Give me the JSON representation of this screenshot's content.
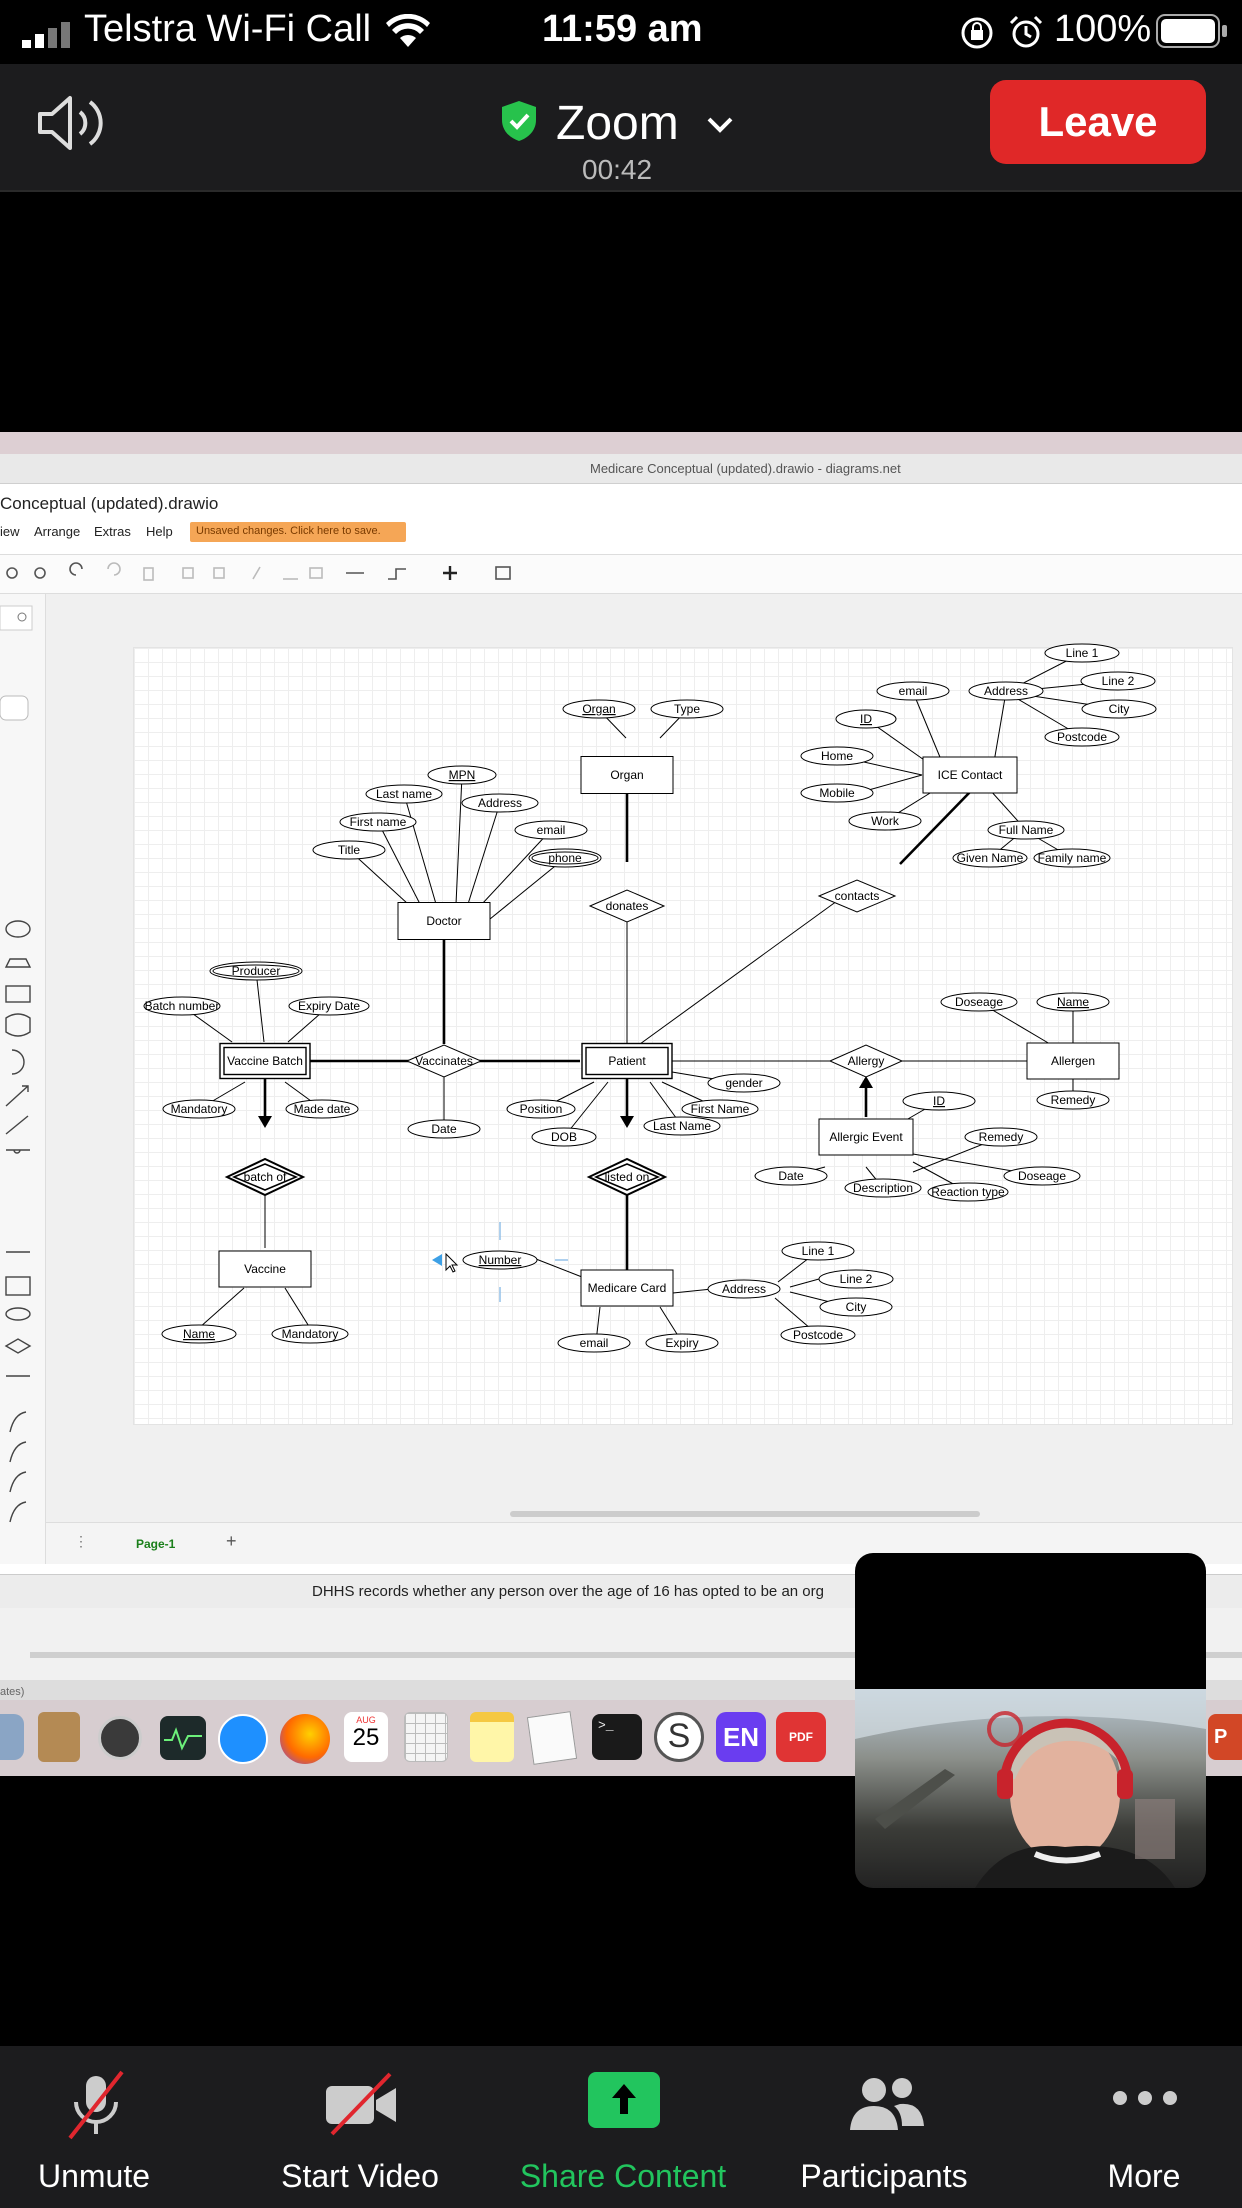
{
  "status_bar": {
    "carrier": "Telstra Wi-Fi Call",
    "time": "11:59 am",
    "battery": "100%"
  },
  "header": {
    "app_name": "Zoom",
    "timer": "00:42",
    "leave_label": "Leave"
  },
  "shared_screen": {
    "window_title": "Medicare Conceptual (updated).drawio - diagrams.net",
    "doc_title": "Conceptual (updated).drawio",
    "menu": [
      "iew",
      "Arrange",
      "Extras",
      "Help"
    ],
    "unsaved_notice": "Unsaved changes. Click here to save.",
    "page_tab": "Page-1",
    "caption": "DHHS records whether any person over the age of 16 has opted to be an org",
    "calendar_month": "AUG",
    "calendar_day": "25",
    "dock_en": "EN",
    "dock_pdf": "PDF",
    "status_fragment": "ates)",
    "diagram": {
      "entities": {
        "organ": "Organ",
        "doctor": "Doctor",
        "ice_contact": "ICE Contact",
        "vaccine_batch": "Vaccine Batch",
        "patient": "Patient",
        "allergen": "Allergen",
        "allergic_event": "Allergic Event",
        "vaccine": "Vaccine",
        "medicare_card": "Medicare Card"
      },
      "relationships": {
        "donates": "donates",
        "contacts": "contacts",
        "vaccinates": "Vaccinates",
        "allergy": "Allergy",
        "batch_of": "batch of",
        "listed_on": "listed on"
      },
      "attributes": {
        "organ_key": "Organ",
        "organ_type": "Type",
        "ice_line1": "Line 1",
        "ice_email": "email",
        "ice_address": "Address",
        "ice_line2": "Line 2",
        "ice_id": "ID",
        "ice_city": "City",
        "ice_postcode": "Postcode",
        "ice_home": "Home",
        "ice_mobile": "Mobile",
        "ice_work": "Work",
        "ice_fullname": "Full Name",
        "ice_given": "Given Name",
        "ice_family": "Family name",
        "doc_mpn": "MPN",
        "doc_lastname": "Last name",
        "doc_address": "Address",
        "doc_firstname": "First name",
        "doc_email": "email",
        "doc_title": "Title",
        "doc_phone": "phone",
        "vb_producer": "Producer",
        "vb_batchnum": "Batch number",
        "vb_expiry": "Expiry Date",
        "vb_mandatory": "Mandatory",
        "vb_madedate": "Made date",
        "vacc_date": "Date",
        "pat_gender": "gender",
        "pat_position": "Position",
        "pat_firstname": "First Name",
        "pat_dob": "DOB",
        "pat_lastname": "Last Name",
        "al_doseage": "Doseage",
        "al_name": "Name",
        "al_remedy": "Remedy",
        "ae_id": "ID",
        "ae_remedy": "Remedy",
        "ae_date": "Date",
        "ae_doseage": "Doseage",
        "ae_description": "Description",
        "ae_reaction": "Reaction type",
        "mc_number": "Number",
        "mc_line1": "Line 1",
        "mc_address": "Address",
        "mc_line2": "Line 2",
        "mc_city": "City",
        "mc_postcode": "Postcode",
        "mc_email": "email",
        "mc_expiry": "Expiry",
        "vac_name": "Name",
        "vac_mandatory": "Mandatory"
      }
    }
  },
  "bottom_bar": {
    "unmute": "Unmute",
    "start_video": "Start Video",
    "share_content": "Share Content",
    "participants": "Participants",
    "more": "More"
  },
  "colors": {
    "leave_red": "#e02828",
    "share_green": "#22c55e",
    "shield_green": "#27c24c",
    "unsaved_orange": "#f5a656"
  }
}
